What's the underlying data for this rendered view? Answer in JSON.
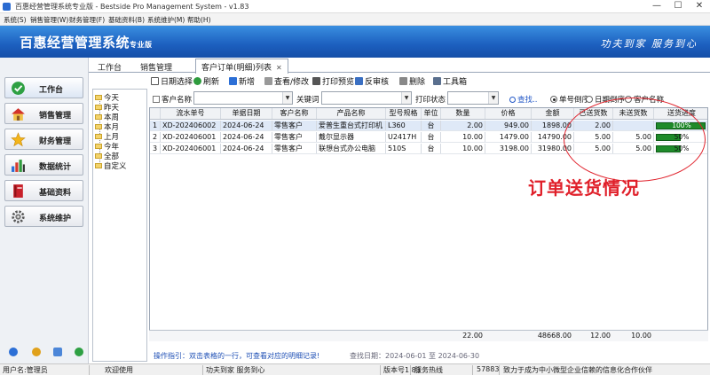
{
  "window": {
    "title": "百惠经营管理系统专业版 - Bestside Pro Management System - v1.83",
    "minimize": "—",
    "maximize": "☐",
    "close": "✕"
  },
  "menu": [
    "系统(S)",
    "销售管理(W)",
    "财务管理(F)",
    "基础资料(B)",
    "系统维护(M)",
    "帮助(H)"
  ],
  "banner": {
    "logo_main": "百惠经营管理系统",
    "logo_sub": "专业版",
    "slogan": "功夫到家  服务到心"
  },
  "nav": [
    {
      "label": "工作台",
      "icon": "check-circle-icon"
    },
    {
      "label": "销售管理",
      "icon": "house-icon"
    },
    {
      "label": "财务管理",
      "icon": "star-icon"
    },
    {
      "label": "数据统计",
      "icon": "chart-icon"
    },
    {
      "label": "基础资料",
      "icon": "book-icon"
    },
    {
      "label": "系统维护",
      "icon": "gear-icon"
    }
  ],
  "tabs": [
    {
      "label": "工作台"
    },
    {
      "label": "销售管理"
    },
    {
      "label": "客户订单(明细)列表",
      "close": "✕"
    }
  ],
  "toolbar": {
    "date_select": "日期选择",
    "refresh": "刷新",
    "new": "新增",
    "view_edit": "查看/修改",
    "print_preview": "打印预览",
    "unaudit": "反审核",
    "delete": "删除",
    "toolbox": "工具箱"
  },
  "tree": [
    "今天",
    "昨天",
    "本周",
    "本月",
    "上月",
    "今年",
    "全部",
    "自定义"
  ],
  "filter": {
    "customer_label": "客户名称",
    "keyword_label": "关键词",
    "print_status_label": "打印状态",
    "search_link": "查找..",
    "radio_order_desc": "单号倒序",
    "radio_date_desc": "日期倒序",
    "radio_customer": "客户名称"
  },
  "grid": {
    "headers": [
      "",
      "流水单号",
      "单据日期",
      "客户名称",
      "产品名称",
      "型号规格",
      "单位",
      "数量",
      "价格",
      "金额",
      "已送货数",
      "未送货数",
      "送货进度"
    ],
    "rows": [
      {
        "no": "1",
        "serial": "XD-202406002",
        "date": "2024-06-24",
        "customer": "零售客户",
        "product": "爱普生重台式打印机",
        "model": "L360",
        "unit": "台",
        "qty": "2.00",
        "price": "949.00",
        "amount": "1898.00",
        "delivered": "2.00",
        "undelivered": "",
        "progress_label": "100%",
        "progress": 100
      },
      {
        "no": "2",
        "serial": "XD-202406001",
        "date": "2024-06-24",
        "customer": "零售客户",
        "product": "戴尔显示器",
        "model": "U2417H",
        "unit": "台",
        "qty": "10.00",
        "price": "1479.00",
        "amount": "14790.00",
        "delivered": "5.00",
        "undelivered": "5.00",
        "progress_label": "50%",
        "progress": 50
      },
      {
        "no": "3",
        "serial": "XD-202406001",
        "date": "2024-06-24",
        "customer": "零售客户",
        "product": "联想台式办公电脑",
        "model": "510S",
        "unit": "台",
        "qty": "10.00",
        "price": "3198.00",
        "amount": "31980.00",
        "delivered": "5.00",
        "undelivered": "5.00",
        "progress_label": "50%",
        "progress": 50
      }
    ],
    "totals": {
      "qty": "22.00",
      "amount": "48668.00",
      "delivered": "12.00",
      "undelivered": "10.00"
    }
  },
  "hint": "操作指引：双击表格的一行，可查看对应的明细记录!",
  "date_range": "查找日期：2024-06-01 至 2024-06-30",
  "annotation": "订单送货情况",
  "status": {
    "user": "用户名:管理员",
    "welcome": "欢迎使用",
    "motto": "功夫到家 服务到心",
    "version": "版本号1.83",
    "service_label": "服务热线",
    "service_no": "57883",
    "mission": "致力于成为中小微型企业信赖的信息化合作伙伴"
  },
  "colors": {
    "banner": "#1c5fbf",
    "progress": "#1e8a2a",
    "annotation": "#e0202a",
    "link": "#1f55c6"
  }
}
